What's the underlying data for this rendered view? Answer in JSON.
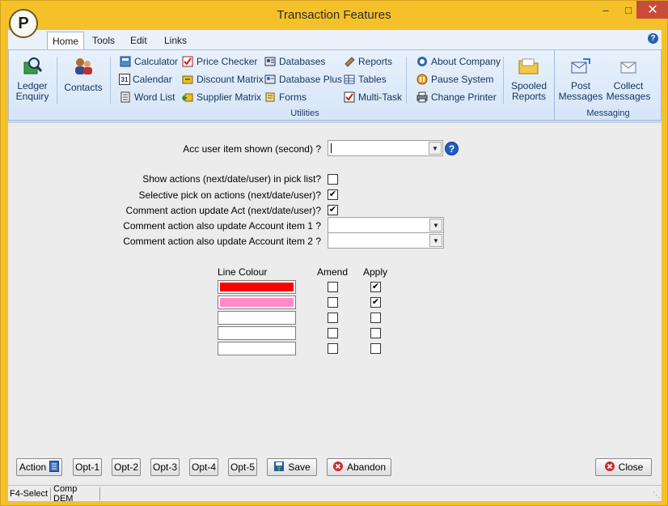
{
  "window": {
    "title": "Transaction Features",
    "logo_letter": "P"
  },
  "ribbon": {
    "tabs": [
      "Home",
      "Tools",
      "Edit",
      "Links"
    ],
    "active_tab": "Home",
    "large_buttons": {
      "ledger_enquiry": [
        "Ledger",
        "Enquiry"
      ],
      "contacts": "Contacts",
      "spooled_reports": [
        "Spooled",
        "Reports"
      ],
      "post_messages": [
        "Post",
        "Messages"
      ],
      "collect_messages": [
        "Collect",
        "Messages"
      ]
    },
    "small_buttons": {
      "col1": [
        "Calculator",
        "Calendar",
        "Word List"
      ],
      "col2": [
        "Price Checker",
        "Discount Matrix",
        "Supplier Matrix"
      ],
      "col3": [
        "Databases",
        "Database Plus",
        "Forms"
      ],
      "col4": [
        "Reports",
        "Tables",
        "Multi-Task"
      ],
      "col5": [
        "About Company",
        "Pause System",
        "Change Printer"
      ]
    },
    "group_labels": {
      "utilities": "Utilities",
      "messaging": "Messaging"
    },
    "calendar_icon_text": "31"
  },
  "form": {
    "acc_user_item_label": "Acc user item shown (second) ?",
    "acc_user_item_value": "",
    "show_actions_label": "Show actions (next/date/user) in pick list?",
    "show_actions_checked": false,
    "selective_pick_label": "Selective pick on actions (next/date/user)?",
    "selective_pick_checked": true,
    "comment_update_act_label": "Comment action update Act (next/date/user)?",
    "comment_update_act_checked": true,
    "account_item1_label": "Comment action also update Account item 1 ?",
    "account_item1_value": "",
    "account_item2_label": "Comment action also update Account item 2 ?",
    "account_item2_value": ""
  },
  "line_colours": {
    "headers": {
      "line_colour": "Line Colour",
      "amend": "Amend",
      "apply": "Apply"
    },
    "rows": [
      {
        "colour": "#ff0000",
        "amend": false,
        "apply": true
      },
      {
        "colour": "#ff8ac8",
        "amend": false,
        "apply": true
      },
      {
        "colour": "#ffffff",
        "amend": false,
        "apply": false
      },
      {
        "colour": "#ffffff",
        "amend": false,
        "apply": false
      },
      {
        "colour": "#ffffff",
        "amend": false,
        "apply": false
      }
    ]
  },
  "buttons": {
    "action": "Action",
    "opt1": "Opt-1",
    "opt2": "Opt-2",
    "opt3": "Opt-3",
    "opt4": "Opt-4",
    "opt5": "Opt-5",
    "save": "Save",
    "abandon": "Abandon",
    "close": "Close"
  },
  "status": {
    "f4": "F4-Select",
    "company": "Comp DEM"
  },
  "colors": {
    "frame": "#f5c12a",
    "ribbon": "#dce9f8",
    "panel": "#ececec",
    "help_blue": "#1e5ec4"
  }
}
